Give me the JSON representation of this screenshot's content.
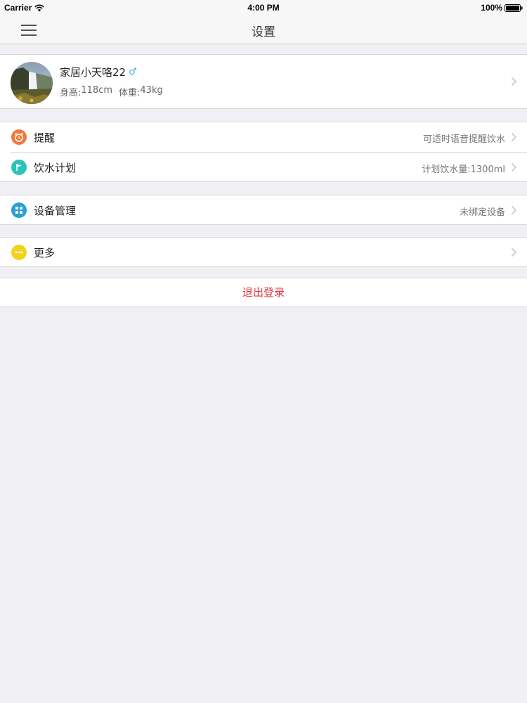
{
  "status_bar": {
    "carrier": "Carrier",
    "time": "4:00 PM",
    "battery": "100%"
  },
  "nav": {
    "title": "设置",
    "menu_icon": "hamburger-menu-icon"
  },
  "profile": {
    "name": "家居小天咯22",
    "gender_symbol": "♂",
    "height_label": "身高:",
    "height_value": "118cm",
    "weight_label": "体重:",
    "weight_value": "43kg"
  },
  "settings": {
    "reminder": {
      "label": "提醒",
      "detail": "可适时语音提醒饮水",
      "icon": "alarm-clock-icon",
      "color": "#f07a3c"
    },
    "plan": {
      "label": "饮水计划",
      "detail": "计划饮水量:1300ml",
      "icon": "flag-icon",
      "color": "#2bc4b6"
    },
    "device": {
      "label": "设备管理",
      "detail": "未绑定设备",
      "icon": "grid-icon",
      "color": "#2a9ed8"
    },
    "more": {
      "label": "更多",
      "detail": "",
      "icon": "ellipsis-icon",
      "color": "#f2d21e"
    }
  },
  "logout": {
    "label": "退出登录",
    "color": "#e5353b"
  }
}
